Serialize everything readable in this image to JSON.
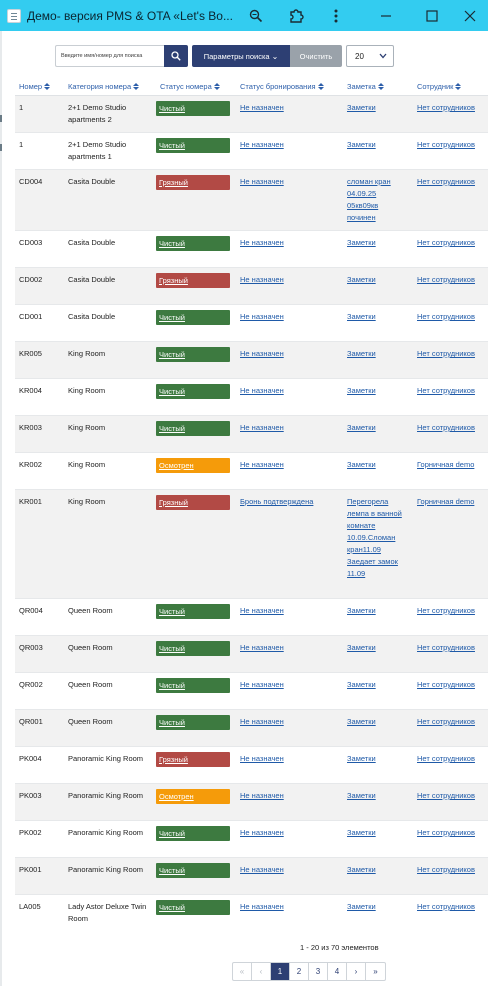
{
  "window": {
    "title": "Демо- версия PMS & OTA «Let's Bo...",
    "icons": [
      "app-icon",
      "zoom-icon",
      "extension-icon",
      "more-vert-icon",
      "minimize-icon",
      "maximize-icon",
      "close-icon"
    ]
  },
  "search": {
    "placeholder": "Введите имя/номер для поиска",
    "params_label": "Параметры поиска",
    "clear_label": "Очистить",
    "page_size": "20"
  },
  "table": {
    "headers": [
      "Номер",
      "Категория номера",
      "Статус номера",
      "Статус бронирования",
      "Заметка",
      "Сотрудник"
    ],
    "rows": [
      {
        "num": "1",
        "category": "2+1 Demo Studio apartments 2",
        "status": "Чистый",
        "status_kind": "clean",
        "booking": "Не назначен",
        "notes": "Заметки",
        "staff": "Нет сотрудников"
      },
      {
        "num": "1",
        "category": "2+1 Demo Studio apartments 1",
        "status": "Чистый",
        "status_kind": "clean",
        "booking": "Не назначен",
        "notes": "Заметки",
        "staff": "Нет сотрудников"
      },
      {
        "num": "CD004",
        "category": "Casita Double",
        "status": "Грязный",
        "status_kind": "dirty",
        "booking": "Не назначен",
        "notes": "сломан кран 04.09.25 05кв09кв починен",
        "staff": "Нет сотрудников"
      },
      {
        "num": "CD003",
        "category": "Casita Double",
        "status": "Чистый",
        "status_kind": "clean",
        "booking": "Не назначен",
        "notes": "Заметки",
        "staff": "Нет сотрудников"
      },
      {
        "num": "CD002",
        "category": "Casita Double",
        "status": "Грязный",
        "status_kind": "dirty",
        "booking": "Не назначен",
        "notes": "Заметки",
        "staff": "Нет сотрудников"
      },
      {
        "num": "CD001",
        "category": "Casita Double",
        "status": "Чистый",
        "status_kind": "clean",
        "booking": "Не назначен",
        "notes": "Заметки",
        "staff": "Нет сотрудников"
      },
      {
        "num": "KR005",
        "category": "King Room",
        "status": "Чистый",
        "status_kind": "clean",
        "booking": "Не назначен",
        "notes": "Заметки",
        "staff": "Нет сотрудников"
      },
      {
        "num": "KR004",
        "category": "King Room",
        "status": "Чистый",
        "status_kind": "clean",
        "booking": "Не назначен",
        "notes": "Заметки",
        "staff": "Нет сотрудников"
      },
      {
        "num": "KR003",
        "category": "King Room",
        "status": "Чистый",
        "status_kind": "clean",
        "booking": "Не назначен",
        "notes": "Заметки",
        "staff": "Нет сотрудников"
      },
      {
        "num": "KR002",
        "category": "King Room",
        "status": "Осмотрен",
        "status_kind": "inspected",
        "booking": "Не назначен",
        "notes": "Заметки",
        "staff": "Горничная demo"
      },
      {
        "num": "KR001",
        "category": "King Room",
        "status": "Грязный",
        "status_kind": "dirty",
        "booking": "Бронь подтверждена",
        "notes": "Перегорела лемпа в ванной комнате 10.09.Сломан кран11.09 Заедает замок 11.09",
        "staff": "Горничная demo"
      },
      {
        "num": "QR004",
        "category": "Queen Room",
        "status": "Чистый",
        "status_kind": "clean",
        "booking": "Не назначен",
        "notes": "Заметки",
        "staff": "Нет сотрудников"
      },
      {
        "num": "QR003",
        "category": "Queen Room",
        "status": "Чистый",
        "status_kind": "clean",
        "booking": "Не назначен",
        "notes": "Заметки",
        "staff": "Нет сотрудников"
      },
      {
        "num": "QR002",
        "category": "Queen Room",
        "status": "Чистый",
        "status_kind": "clean",
        "booking": "Не назначен",
        "notes": "Заметки",
        "staff": "Нет сотрудников"
      },
      {
        "num": "QR001",
        "category": "Queen Room",
        "status": "Чистый",
        "status_kind": "clean",
        "booking": "Не назначен",
        "notes": "Заметки",
        "staff": "Нет сотрудников"
      },
      {
        "num": "PK004",
        "category": "Panoramic King Room",
        "status": "Грязный",
        "status_kind": "dirty",
        "booking": "Не назначен",
        "notes": "Заметки",
        "staff": "Нет сотрудников"
      },
      {
        "num": "PK003",
        "category": "Panoramic King Room",
        "status": "Осмотрен",
        "status_kind": "inspected",
        "booking": "Не назначен",
        "notes": "Заметки",
        "staff": "Нет сотрудников"
      },
      {
        "num": "PK002",
        "category": "Panoramic King Room",
        "status": "Чистый",
        "status_kind": "clean",
        "booking": "Не назначен",
        "notes": "Заметки",
        "staff": "Нет сотрудников"
      },
      {
        "num": "PK001",
        "category": "Panoramic King Room",
        "status": "Чистый",
        "status_kind": "clean",
        "booking": "Не назначен",
        "notes": "Заметки",
        "staff": "Нет сотрудников"
      },
      {
        "num": "LA005",
        "category": "Lady Astor Deluxe Twin Room",
        "status": "Чистый",
        "status_kind": "clean",
        "booking": "Не назначен",
        "notes": "Заметки",
        "staff": "Нет сотрудников"
      }
    ]
  },
  "footer": {
    "summary": "1 - 20 из 70 элементов",
    "pages": [
      "«",
      "‹",
      "1",
      "2",
      "3",
      "4",
      "›",
      "»"
    ],
    "current_page": "1"
  },
  "colors": {
    "titlebar": "#33ccf0",
    "primary": "#2d3f73",
    "clean": "#3d7a40",
    "dirty": "#b24a45",
    "inspected": "#f59b0a",
    "link": "#1f5aa8"
  }
}
